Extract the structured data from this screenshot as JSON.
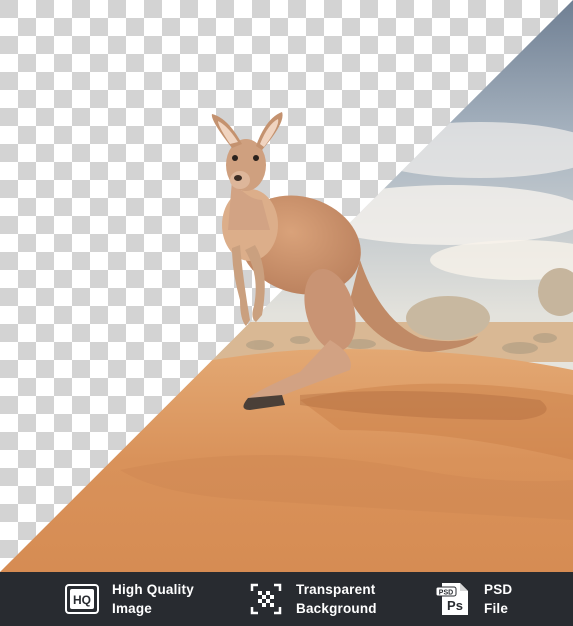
{
  "footer": {
    "features": [
      {
        "icon": "hq-icon",
        "line1": "High Quality",
        "line2": "Image"
      },
      {
        "icon": "transparent-background-icon",
        "line1": "Transparent",
        "line2": "Background"
      },
      {
        "icon": "psd-file-icon",
        "line1": "PSD",
        "line2": "File"
      }
    ],
    "hq_badge": "HQ",
    "psd_badge_top": "PSD",
    "psd_badge_main": "Ps"
  },
  "colors": {
    "footer_bg": "#282b30",
    "sand": "#d8935a",
    "sky": "#9eb0c4",
    "checker_light": "#ffffff",
    "checker_dark": "#cfcfcf"
  }
}
